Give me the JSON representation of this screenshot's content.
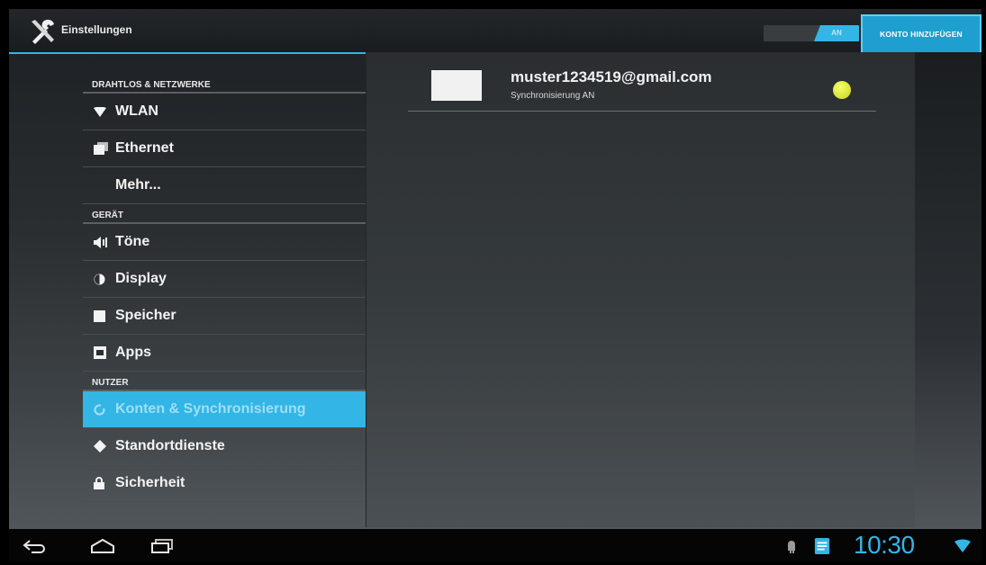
{
  "header": {
    "title": "Einstellungen",
    "toggle_label": "AN",
    "add_account_label": "KONTO HINZUFÜGEN"
  },
  "sidebar": {
    "sections": [
      {
        "label": "DRAHTLOS & NETZWERKE",
        "items": [
          {
            "label": "WLAN",
            "icon": "wifi-icon"
          },
          {
            "label": "Ethernet",
            "icon": "ethernet-icon"
          },
          {
            "label": "Mehr...",
            "icon": ""
          }
        ]
      },
      {
        "label": "GERÄT",
        "items": [
          {
            "label": "Töne",
            "icon": "speaker-icon"
          },
          {
            "label": "Display",
            "icon": "display-icon"
          },
          {
            "label": "Speicher",
            "icon": "storage-icon"
          },
          {
            "label": "Apps",
            "icon": "apps-icon"
          }
        ]
      },
      {
        "label": "NUTZER",
        "items": [
          {
            "label": "Konten & Synchronisierung",
            "icon": "sync-icon",
            "active": true
          },
          {
            "label": "Standortdienste",
            "icon": "location-icon"
          },
          {
            "label": "Sicherheit",
            "icon": "lock-icon"
          }
        ]
      }
    ]
  },
  "account": {
    "email": "muster1234519@gmail.com",
    "status": "Synchronisierung AN",
    "sync_color": "#d9e52a"
  },
  "statusbar": {
    "time": "10:30"
  },
  "colors": {
    "accent": "#33b5e5"
  }
}
